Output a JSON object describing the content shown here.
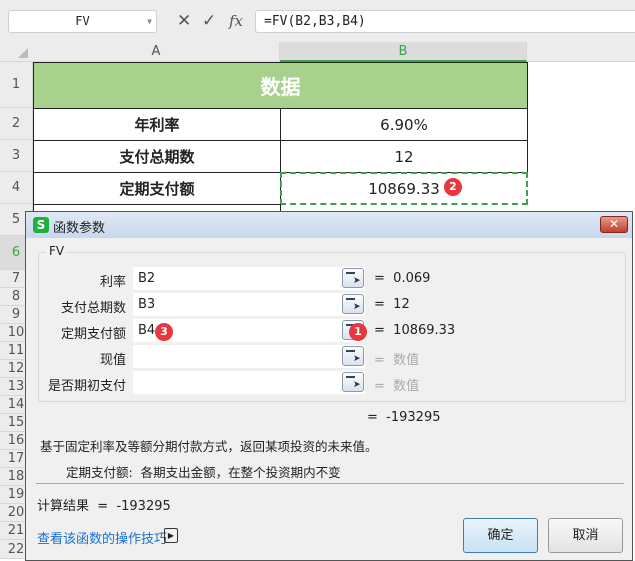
{
  "formula_bar": {
    "name_box": "FV",
    "cancel_icon": "✕",
    "confirm_icon": "✓",
    "fx_label": "fx",
    "formula": "=FV(B2,B3,B4)"
  },
  "columns": [
    "A",
    "B"
  ],
  "rows": [
    "1",
    "2",
    "3",
    "4",
    "5",
    "6",
    "7",
    "8",
    "9",
    "10",
    "11",
    "12",
    "13",
    "14",
    "15",
    "16",
    "17",
    "18",
    "19",
    "20",
    "21",
    "22"
  ],
  "sheet": {
    "header": "数据",
    "labels": [
      "年利率",
      "支付总期数",
      "定期支付额"
    ],
    "values": [
      "6.90%",
      "12",
      "10869.33"
    ]
  },
  "badges": [
    "1",
    "2",
    "3"
  ],
  "dialog": {
    "title": "函数参数",
    "app_icon": "S",
    "group": "FV",
    "args": [
      {
        "label": "利率",
        "value": "B2",
        "result": "0.069"
      },
      {
        "label": "支付总期数",
        "value": "B3",
        "result": "12"
      },
      {
        "label": "定期支付额",
        "value": "B4",
        "result": "10869.33"
      },
      {
        "label": "现值",
        "value": "",
        "result": "数值"
      },
      {
        "label": "是否期初支付",
        "value": "",
        "result": "数值"
      }
    ],
    "eq": "=",
    "formula_result": "-193295",
    "description": "基于固定利率及等额分期付款方式，返回某项投资的未来值。",
    "arg_desc_label": "定期支付额:",
    "arg_desc": "各期支出金额，在整个投资期内不变",
    "calc_label": "计算结果",
    "calc_value": "-193295",
    "help_link": "查看该函数的操作技巧",
    "ok": "确定",
    "cancel": "取消"
  },
  "colors": {
    "header_green": "#a9d18e",
    "accent": "#3da34a",
    "badge": "#e8373e"
  }
}
